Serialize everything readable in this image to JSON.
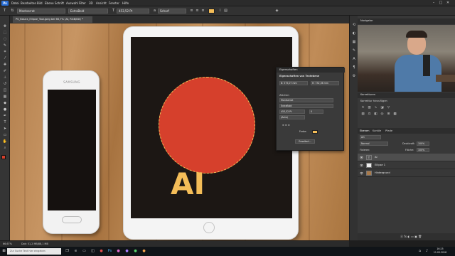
{
  "menubar": {
    "logo": "Ps",
    "items": [
      "Datei",
      "Bearbeiten",
      "Bild",
      "Ebene",
      "Schrift",
      "Auswahl",
      "Filter",
      "3D",
      "Ansicht",
      "Fenster",
      "Hilfe"
    ],
    "window_controls": [
      "–",
      "□",
      "✕"
    ]
  },
  "options": {
    "tool_icon": "T",
    "font_family": "Montserrat",
    "font_style": "ExtraBold",
    "font_size": "453,52 Pt",
    "antialias_icon": "a",
    "antialias": "Scharf",
    "color": "#f4bd58"
  },
  "document": {
    "tab_title": "PS_Basics_Ellipse_Tool.jpeg bei 66,7% (AI, RGB/8#) *"
  },
  "canvas": {
    "phone_brand": "SAMSUNG",
    "ai_text": "AI",
    "circle_color": "#d6402c",
    "text_color": "#f4bd58"
  },
  "properties_panel": {
    "header": "Eigenschaften",
    "subheader": "Eigenschaften von Textebene",
    "w": "B: 575,07 mm",
    "h": "H: 732,36 mm",
    "font_family": "Montserrat",
    "font_style": "ExtraBold",
    "font_size": "453,52 Pt",
    "leading": "(Auto)",
    "tracking": "0",
    "color_label": "Farbe:",
    "button": "Erweitert..."
  },
  "right_dock": {
    "navigator_title": "Navigator",
    "corrections_title": "Korrekturen",
    "corrections_sub": "Korrektur hinzufügen",
    "layers_tabs": [
      "Ebenen",
      "Kanäle",
      "Pfade"
    ],
    "kind_label": "Art",
    "blend_mode": "Normal",
    "opacity_label": "Deckkraft:",
    "opacity_value": "100%",
    "fix_label": "Fixieren:",
    "fill_label": "Fläche:",
    "fill_value": "100%",
    "layers": [
      {
        "name": "AI",
        "selected": true
      },
      {
        "name": "Ellipse 1",
        "selected": false
      },
      {
        "name": "Hintergrund",
        "selected": false
      }
    ]
  },
  "statusbar": {
    "zoom": "66,67%",
    "doc": "Dok: 51,2 MB/88,1 MB"
  },
  "taskbar": {
    "search_placeholder": "Zur Suche Text hier eingeben",
    "time": "16:25",
    "date": "11.05.2018"
  }
}
